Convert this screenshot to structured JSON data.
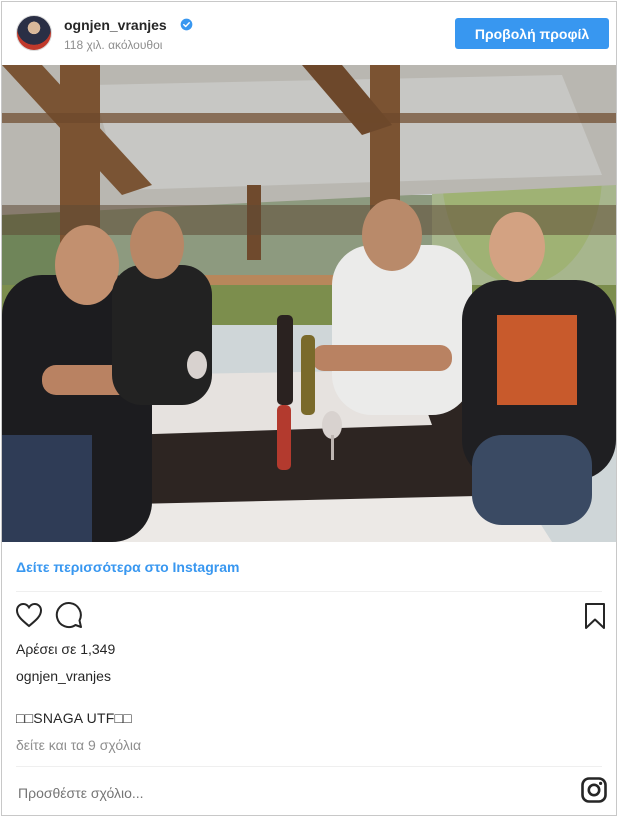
{
  "header": {
    "username": "ognjen_vranjes",
    "followers": "118 χιλ. ακόλουθοι",
    "profile_button": "Προβολή προφίλ"
  },
  "more_link": "Δείτε περισσότερα στο Instagram",
  "post": {
    "likes": "Αρέσει σε 1,349",
    "owner": "ognjen_vranjes",
    "caption": "□□SNAGA UTF□□",
    "comments_link": "δείτε και τα 9 σχόλια",
    "comment_placeholder": "Προσθέστε σχόλιο..."
  },
  "icons": {
    "like": "heart-icon",
    "comment": "comment-icon",
    "save": "bookmark-icon",
    "instagram": "instagram-icon",
    "verified": "verified-badge-icon"
  },
  "colors": {
    "accent": "#3897f0",
    "text": "#262626",
    "muted": "#8e8e8e"
  }
}
